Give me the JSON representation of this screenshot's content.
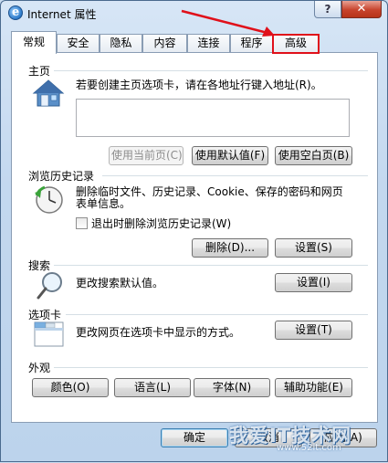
{
  "window": {
    "title": "Internet 属性",
    "help_label": "?",
    "close_label": "✕"
  },
  "tabs": [
    {
      "label": "常规",
      "active": true
    },
    {
      "label": "安全"
    },
    {
      "label": "隐私"
    },
    {
      "label": "内容"
    },
    {
      "label": "连接"
    },
    {
      "label": "程序"
    },
    {
      "label": "高级",
      "highlighted": true
    }
  ],
  "homepage": {
    "title": "主页",
    "description": "若要创建主页选项卡，请在各地址行键入地址(R)。",
    "address_value": "",
    "buttons": {
      "use_current": "使用当前页(C)",
      "use_default": "使用默认值(F)",
      "use_blank": "使用空白页(B)"
    }
  },
  "history": {
    "title": "浏览历史记录",
    "description_line1": "删除临时文件、历史记录、Cookie、保存的密码和网页",
    "description_line2": "表单信息。",
    "checkbox_label": "退出时删除浏览历史记录(W)",
    "buttons": {
      "delete": "删除(D)...",
      "settings": "设置(S)"
    }
  },
  "search": {
    "title": "搜索",
    "description": "更改搜索默认值。",
    "settings_label": "设置(I)"
  },
  "tabs_section": {
    "title": "选项卡",
    "description": "更改网页在选项卡中显示的方式。",
    "settings_label": "设置(T)"
  },
  "appearance": {
    "title": "外观",
    "buttons": {
      "colors": "颜色(O)",
      "languages": "语言(L)",
      "fonts": "字体(N)",
      "accessibility": "辅助功能(E)"
    }
  },
  "dialog_buttons": {
    "ok": "确定",
    "cancel": "取消",
    "apply": "应用(A)"
  },
  "watermark": {
    "text": "我爱IT技术网",
    "url": "www.52it.com"
  },
  "colors": {
    "annotation": "#e0101a",
    "selected_tab_bg": "#ffffff"
  }
}
